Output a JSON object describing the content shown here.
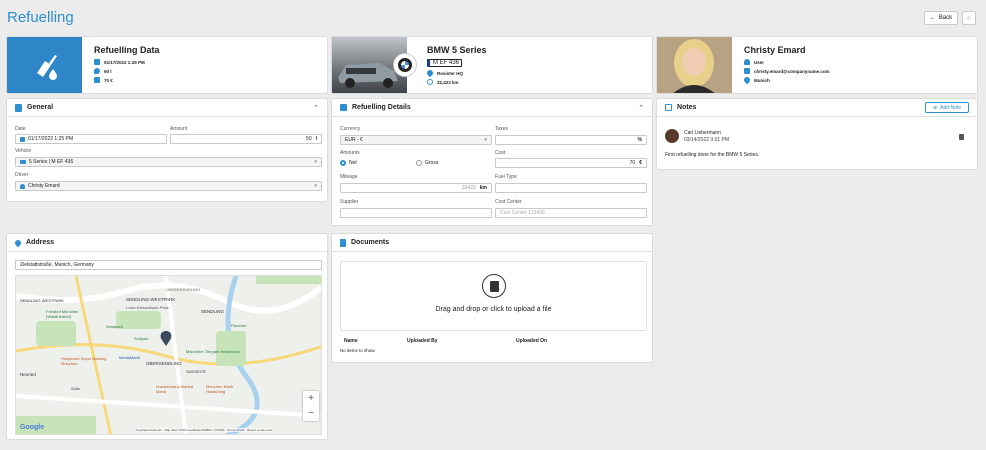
{
  "page": {
    "title": "Refuelling",
    "back_label": "Back",
    "star_icon": "star-icon"
  },
  "summary": {
    "refuel": {
      "title": "Refuelling Data",
      "date": "01/17/2022 1:25 PM",
      "volume": "50 l",
      "price": "70 €"
    },
    "vehicle": {
      "title": "BMW 5 Series",
      "plate": "M EF 436",
      "location": "Rosister HQ",
      "mileage": "32,423 km"
    },
    "person": {
      "name": "Christy Emard",
      "role": "User",
      "email": "christy.emard@companyname.com",
      "city": "Munich"
    }
  },
  "general": {
    "header": "General",
    "date_label": "Date",
    "date_value": "01/17/2022 1:25 PM",
    "amount_label": "Amount",
    "amount_value": "50",
    "amount_unit": "l",
    "vehicle_label": "Vehicle",
    "vehicle_value": "5 Series | M EF 436",
    "driver_label": "Driver",
    "driver_value": "Christy Emard"
  },
  "details": {
    "header": "Refuelling Details",
    "currency_label": "Currency",
    "currency_value": "EUR - €",
    "taxes_label": "Taxes",
    "taxes_unit": "%",
    "amounts_label": "Amounts",
    "net_label": "Net",
    "gross_label": "Gross",
    "cost_label": "Cost",
    "cost_value": "70",
    "cost_unit": "€",
    "mileage_label": "Mileage",
    "mileage_value": "32423",
    "mileage_unit": "km",
    "fuel_type_label": "Fuel Type",
    "supplier_label": "Supplier",
    "cost_center_label": "Cost Center",
    "cost_center_placeholder": "Cost Center 123456"
  },
  "notes": {
    "header": "Notes",
    "add_label": "Add Note",
    "author": "Carl Liebermann",
    "date": "03/14/2022 3:01 PM",
    "text": "First refuelling done for the BMW 5 Series."
  },
  "address": {
    "header": "Address",
    "value": "Zielstattstraße, Munich, Germany",
    "map_labels": [
      "SENDLING-WESTPARK",
      "SENDLING",
      "UNTERSENDLING",
      "OBERSENDLING",
      "SÜDSEITE",
      "Neuried",
      "Solln",
      "Flaucher",
      "Münchner Tierpark Hellabrunn",
      "Friedhof München (Waldfriedhof)",
      "Luise-Kiesselbach-Platz",
      "Westpark",
      "Sollpark",
      "MediaMarkt",
      "Hollywood Super Bowling München",
      "Krankenhaus Martha Maria",
      "München Klinik Harlaching"
    ],
    "google": "Google",
    "attribution": "Keyboard shortcuts   Map data ©2022 GeoBasis-DE/BKG (©2009)   Terms of Use   Report a map error",
    "zoom_in": "+",
    "zoom_out": "−"
  },
  "documents": {
    "header": "Documents",
    "drop_text": "Drag and drop or click to upload a file",
    "col_name": "Name",
    "col_uploaded_by": "Uploaded By",
    "col_uploaded_on": "Uploaded On",
    "empty": "No items to show."
  },
  "colors": {
    "accent": "#2e8fd0",
    "hero": "#2e86c9"
  }
}
